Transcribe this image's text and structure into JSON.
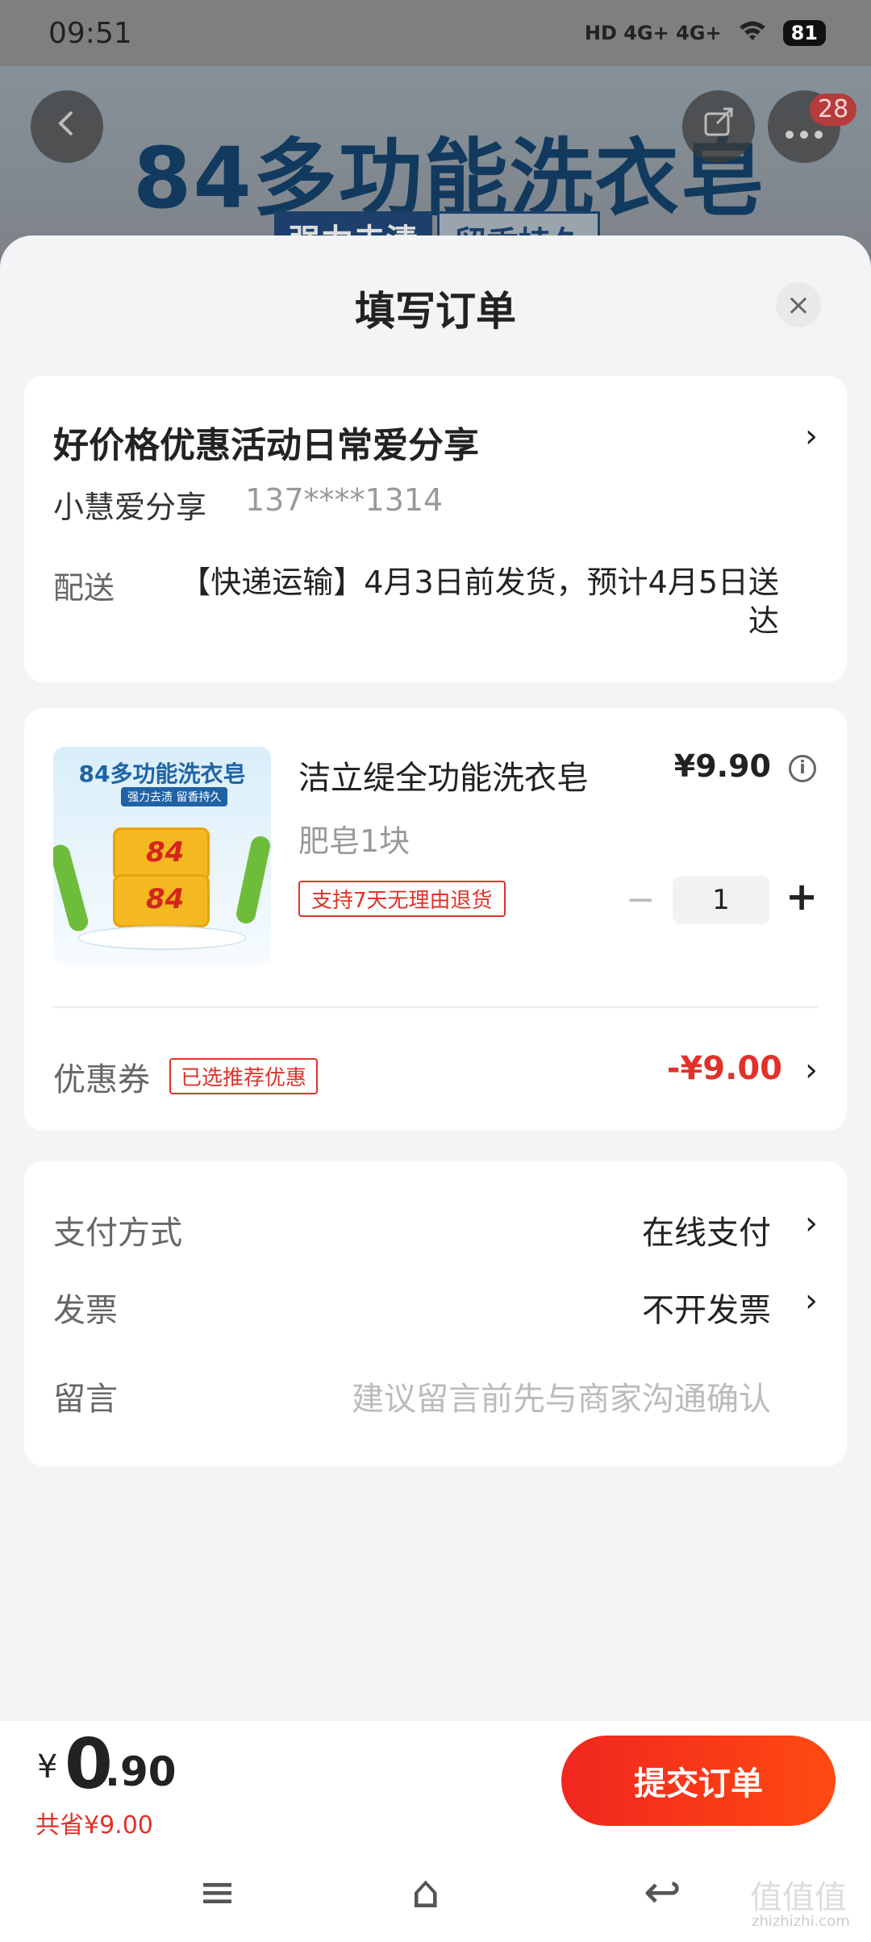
{
  "status_bar": {
    "time": "09:51",
    "network": "HD 4G+ 4G+",
    "battery": "81"
  },
  "background": {
    "banner_title": "84多功能洗衣皂",
    "banner_sub1": "强力去渍",
    "banner_sub2": "留香持久",
    "cart_badge": "28"
  },
  "sheet": {
    "title": "填写订单",
    "close_icon": "×"
  },
  "address": {
    "name": "好价格优惠活动日常爱分享",
    "contact": "小慧爱分享",
    "phone": "137****1314",
    "ship_label": "配送",
    "ship_text": "【快递运输】4月3日前发货，预计4月5日送达"
  },
  "product": {
    "image_title": "84多功能洗衣皂",
    "image_sub": "强力去渍 留香持久",
    "soap_logo": "84",
    "name": "洁立缇全功能洗衣皂",
    "price": "¥9.90",
    "spec": "肥皂1块",
    "return_tag": "支持7天无理由退货",
    "quantity": "1",
    "minus": "−",
    "plus": "+"
  },
  "coupon": {
    "label": "优惠券",
    "tag": "已选推荐优惠",
    "value": "-¥9.00"
  },
  "options": {
    "payment_label": "支付方式",
    "payment_value": "在线支付",
    "invoice_label": "发票",
    "invoice_value": "不开发票",
    "message_label": "留言",
    "message_placeholder": "建议留言前先与商家沟通确认"
  },
  "footer": {
    "currency": "¥",
    "total_int": "0",
    "total_dec": ".90",
    "saved": "共省¥9.00",
    "submit": "提交订单"
  },
  "nav": {
    "menu": "≡",
    "home": "⌂",
    "back": "↩",
    "watermark": "值值值",
    "watermark_url": "zhizhizhi.com"
  },
  "colors": {
    "accent": "#e0322a",
    "button_start": "#f0261f",
    "button_end": "#ff4a12"
  }
}
